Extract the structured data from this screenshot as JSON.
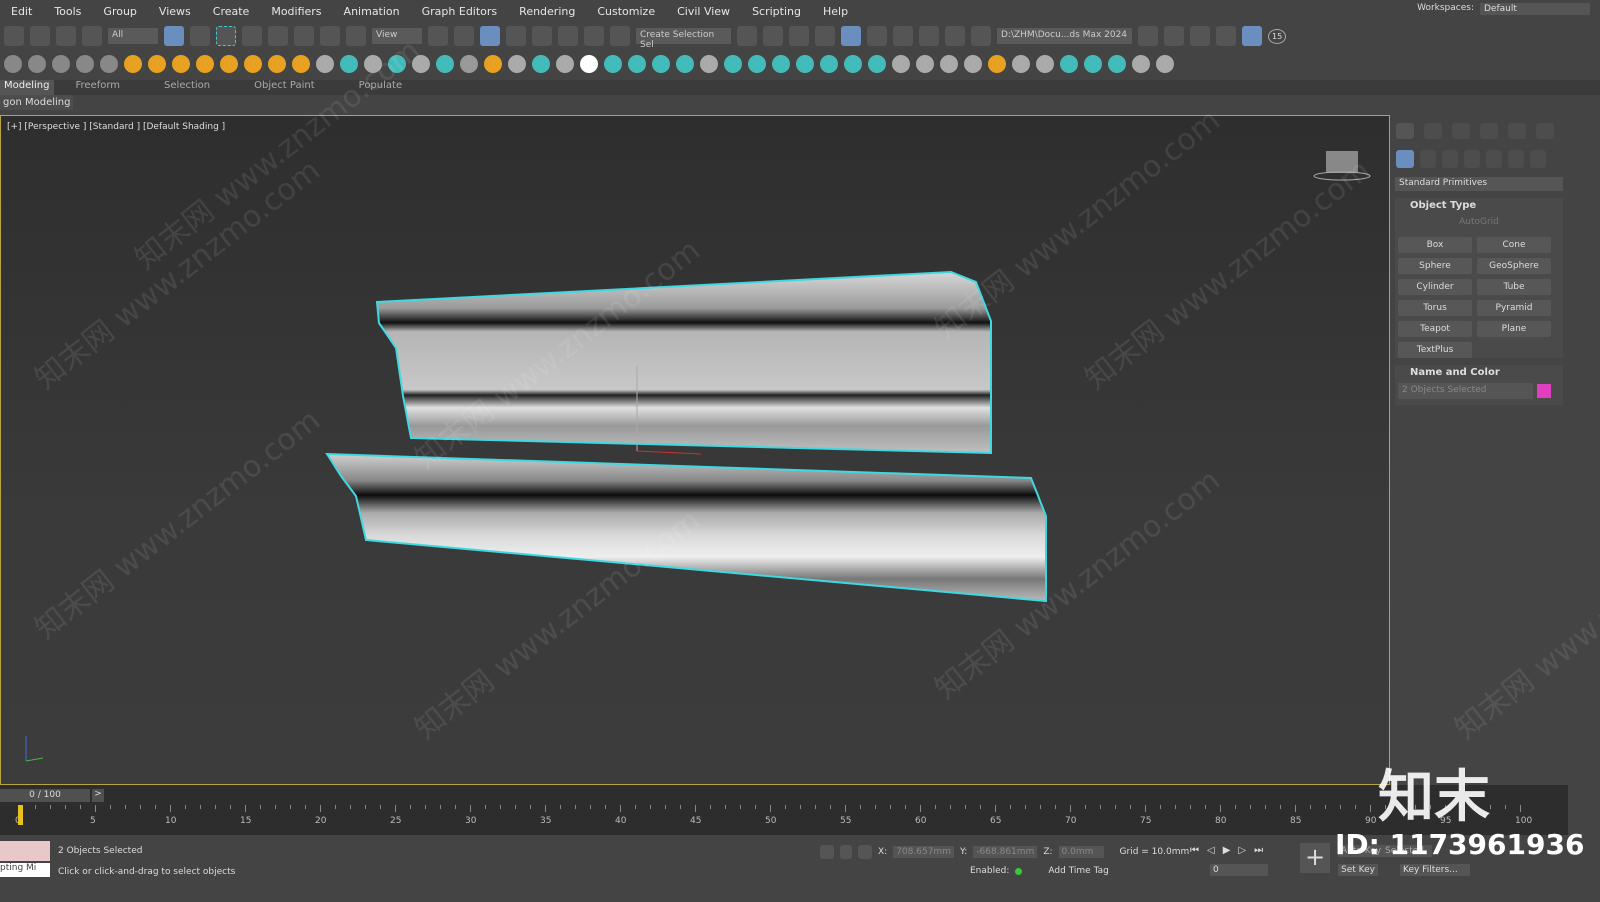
{
  "menu": [
    "Edit",
    "Tools",
    "Group",
    "Views",
    "Create",
    "Modifiers",
    "Animation",
    "Graph Editors",
    "Rendering",
    "Customize",
    "Civil View",
    "Scripting",
    "Help"
  ],
  "workspace": {
    "label": "Workspaces:",
    "value": "Default"
  },
  "toolbar": {
    "filter": "All",
    "ref_coord": "View",
    "selection_set": "Create Selection Sel",
    "project_path": "D:\\ZHM\\Docu...ds Max 2024",
    "snap_count": "15"
  },
  "ribbon": {
    "tabs": [
      "Modeling",
      "Freeform",
      "Selection",
      "Object Paint",
      "Populate"
    ],
    "sub": "gon Modeling"
  },
  "viewport": {
    "label": "[+] [Perspective ] [Standard ] [Default Shading ]",
    "accent": "#40d8e0"
  },
  "panel": {
    "dropdown": "Standard Primitives",
    "object_type": "Object Type",
    "autogrid": "AutoGrid",
    "buttons": [
      "Box",
      "Cone",
      "Sphere",
      "GeoSphere",
      "Cylinder",
      "Tube",
      "Torus",
      "Pyramid",
      "Teapot",
      "Plane",
      "TextPlus"
    ],
    "name_color": "Name and Color",
    "name_value": "2 Objects Selected",
    "color": "#e040c0"
  },
  "timeline": {
    "slider": "0 / 100",
    "ticks": [
      "0",
      "5",
      "10",
      "15",
      "20",
      "25",
      "30",
      "35",
      "40",
      "45",
      "50",
      "55",
      "60",
      "65",
      "70",
      "75",
      "80",
      "85",
      "90",
      "95",
      "100"
    ]
  },
  "status": {
    "selected": "2 Objects Selected",
    "prompt": "Click or click-and-drag to select objects",
    "script": "pting Mi",
    "x": "708.657mm",
    "y": "-668.861mm",
    "z": "0.0mm",
    "grid": "Grid = 10.0mm",
    "enabled": "Enabled:",
    "add_time_tag": "Add Time Tag",
    "auto_key": "Auto Key",
    "selected_mode": "Selected",
    "set_key": "Set Key",
    "key_filters": "Key Filters...",
    "frame": "0"
  },
  "watermark": {
    "text": "知末网 www.znzmo.com",
    "logo": "知末",
    "id": "ID: 1173961936"
  }
}
